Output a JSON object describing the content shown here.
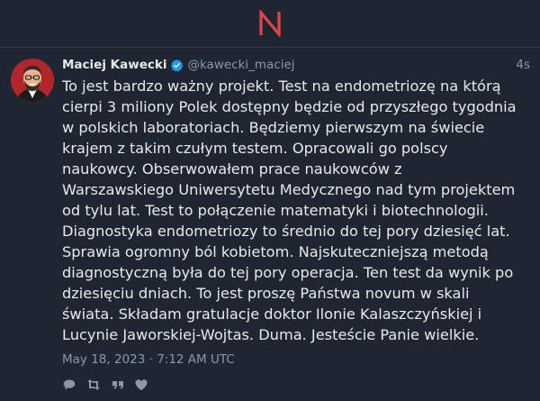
{
  "tweet": {
    "author_name": "Maciej Kawecki",
    "author_handle": "@kawecki_maciej",
    "relative_time": "4s",
    "text": "To jest bardzo ważny projekt. Test na endometriozę na którą\ncierpi 3 miliony Polek dostępny będzie od przyszłego tygodnia\nw polskich laboratoriach. Będziemy pierwszym na świecie\nkrajem z takim czułym testem. Opracowali go polscy\nnaukowcy. Obserwowałem prace naukowców z\nWarszawskiego Uniwersytetu Medycznego nad tym projektem\nod tylu lat. Test to połączenie matematyki i biotechnologii.\nDiagnostyka endometriozy to średnio do tej pory dziesięć lat.\nSprawia ogromny ból kobietom. Najskuteczniejszą metodą\ndiagnostyczną była do tej pory operacja. Ten test da wynik po\ndziesięciu dniach. To jest proszę Państwa novum w skali\nświata. Składam gratulacje doktor Ilonie Kalaszczyńskiej i\nLucynie Jaworskiej-Wojtas. Duma. Jesteście Panie wielkie.",
    "timestamp": "May 18, 2023 · 7:12 AM UTC"
  },
  "icons": {
    "logo": "app-logo-n",
    "verified": "verified-badge-icon",
    "actions": [
      "reply-icon",
      "retweet-icon",
      "quote-icon",
      "like-icon"
    ]
  },
  "colors": {
    "background": "#1e2631",
    "logo_red": "#e0454a",
    "verified_blue": "#1d9bf0",
    "muted_text": "#8b98a5"
  }
}
